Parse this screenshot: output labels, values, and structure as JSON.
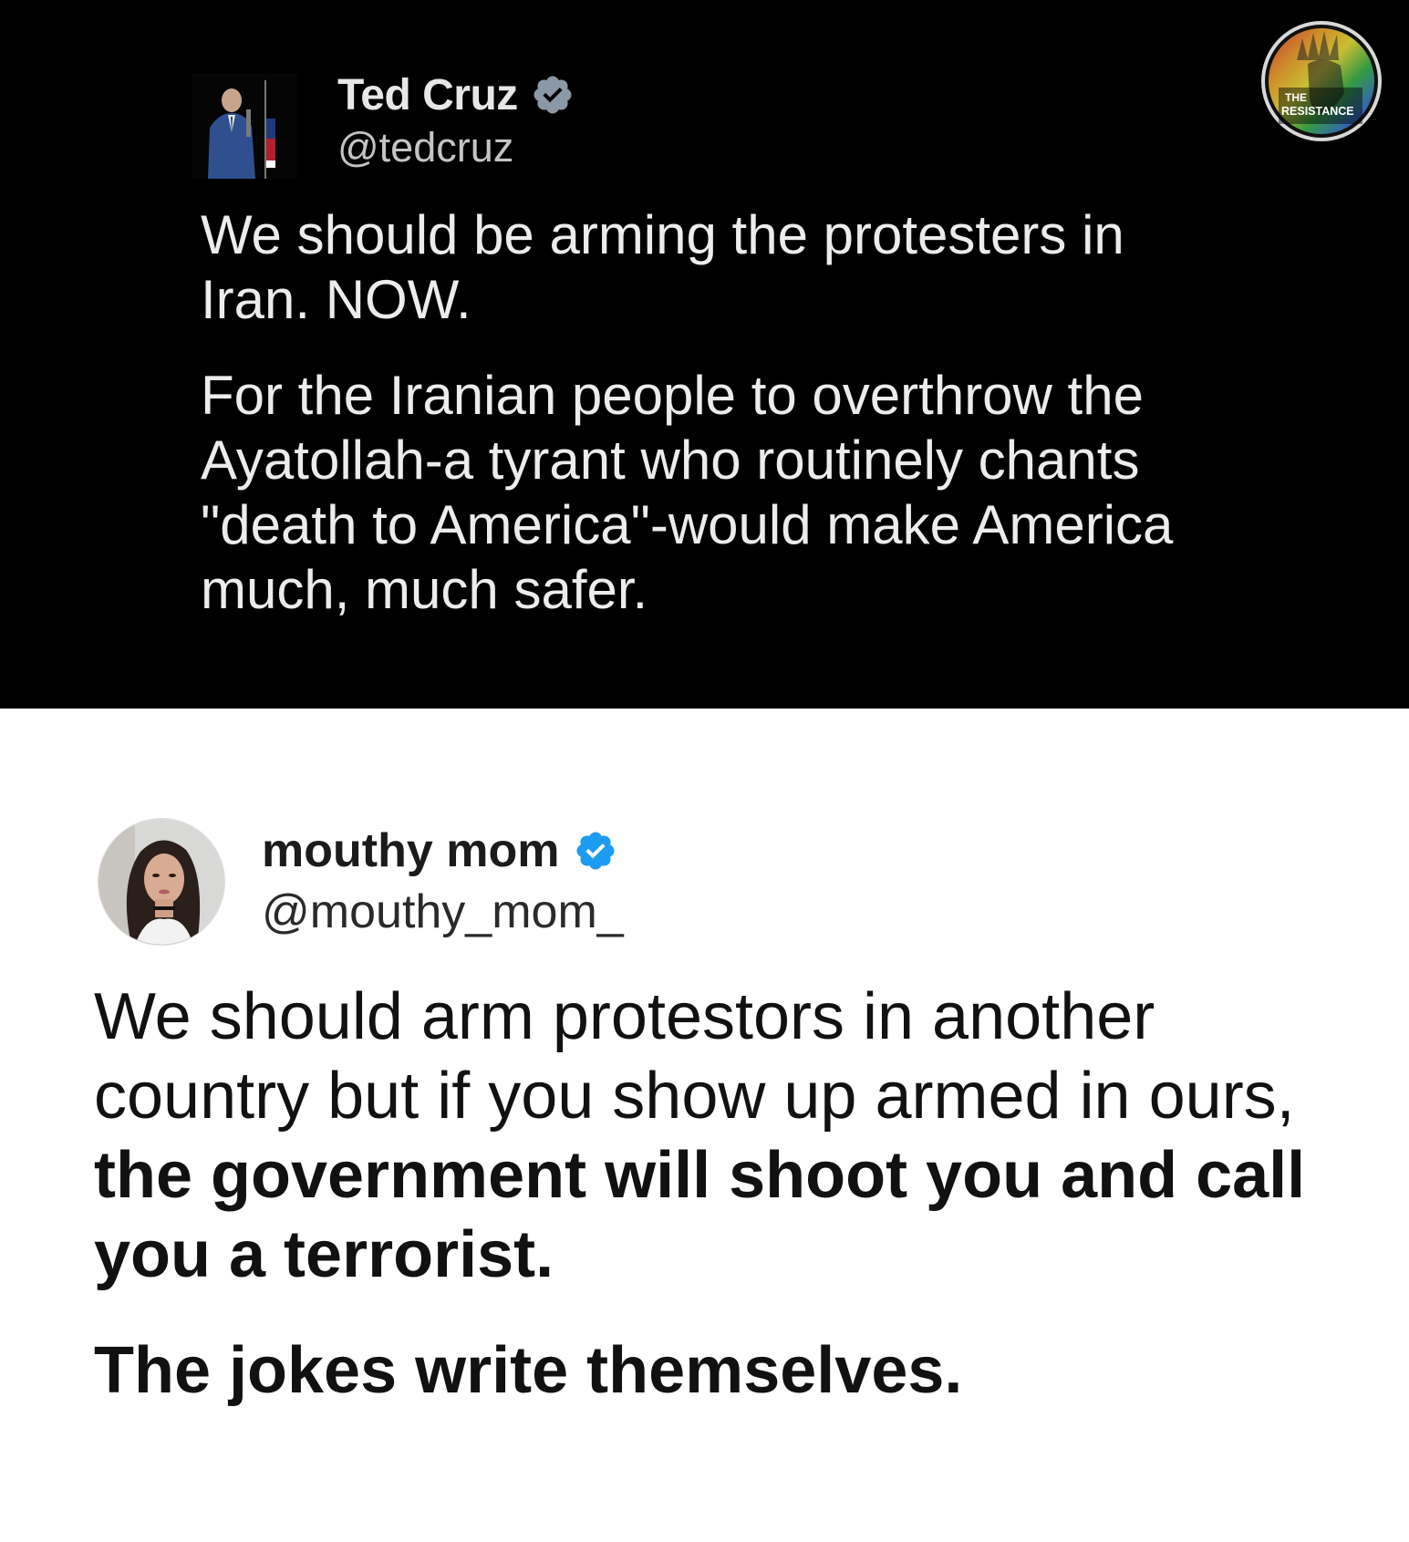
{
  "top_tweet": {
    "display_name": "Ted Cruz",
    "handle": "@tedcruz",
    "verified": true,
    "verified_color": "#8b98a5",
    "background": "#000000",
    "paragraph_1": "We should be arming the protesters in Iran. NOW.",
    "paragraph_2": "For the Iranian people to overthrow the Ayatollah-a tyrant who routinely chants \"death to America\"-would make America much, much safer."
  },
  "watermark": {
    "line_1": "THE",
    "line_2": "RESISTANCE"
  },
  "bottom_tweet": {
    "display_name": "mouthy mom",
    "handle": "@mouthy_mom_",
    "verified": true,
    "verified_color": "#1d9bf0",
    "paragraph_1_regular": "We should arm protestors in another country but if you show up armed in ours, ",
    "paragraph_1_bold": "the government will shoot you and call you a terrorist.",
    "paragraph_2_bold": "The jokes write themselves."
  }
}
